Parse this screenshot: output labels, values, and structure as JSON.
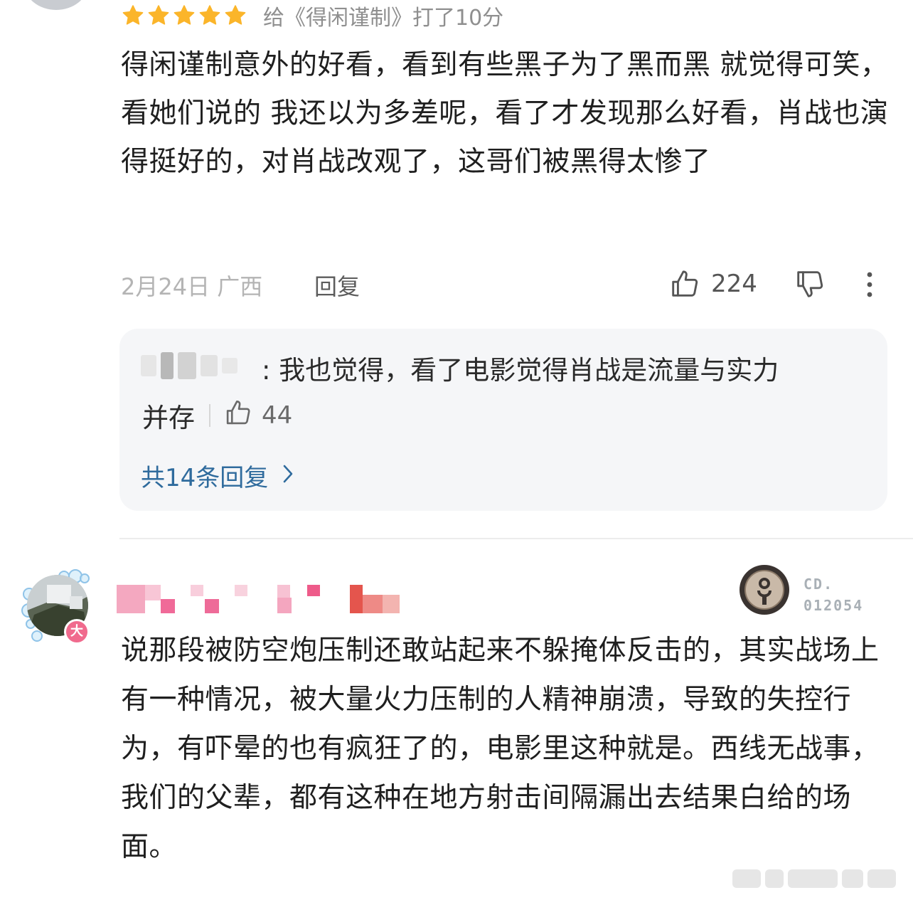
{
  "comment1": {
    "rating_stars": 5,
    "rating_text": "给《得闲谨制》打了10分",
    "body": "得闲谨制意外的好看，看到有些黑子为了黑而黑 就觉得可笑，看她们说的 我还以为多差呢，看了才发现那么好看，肖战也演得挺好的，对肖战改观了，这哥们被黑得太惨了",
    "date_location": "2月24日 广西",
    "reply_label": "回复",
    "like_count": "224",
    "reply_preview": {
      "name_tail": "q",
      "text_line1": ": 我也觉得，看了电影觉得肖战是流量与实力",
      "text_line2": "并存",
      "like_count": "44"
    },
    "more_replies_label": "共14条回复"
  },
  "comment2": {
    "level_badge": "大",
    "medal_text_line1": "CD.",
    "medal_text_line2": "012054",
    "body": "说那段被防空炮压制还敢站起来不躲掩体反击的，其实战场上有一种情况，被大量火力压制的人精神崩溃，导致的失控行为，有吓晕的也有疯狂了的，电影里这种就是。西线无战事，我们的父辈，都有这种在地方射击间隔漏出去结果白给的场面。"
  },
  "colors": {
    "star": "#fbb52a",
    "link": "#2f6b9d",
    "reply_bg": "#f5f6f8",
    "badge": "#f06a8d"
  },
  "icons": {
    "star": "star-icon",
    "like": "thumbs-up-icon",
    "dislike": "thumbs-down-icon",
    "more": "more-vertical-icon",
    "chevron": "chevron-right-icon"
  }
}
